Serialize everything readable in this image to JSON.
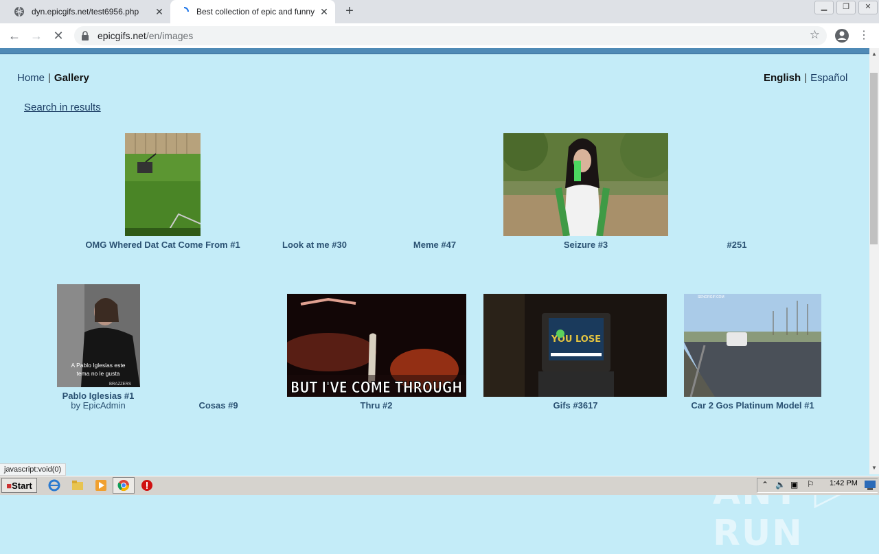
{
  "browser": {
    "tabs": [
      {
        "title": "dyn.epicgifs.net/test6956.php",
        "active": false
      },
      {
        "title": "Best collection of epic and funny gifs",
        "active": true
      }
    ],
    "url_host": "epicgifs.net",
    "url_path": "/en/images",
    "new_tab": "+",
    "window_controls": [
      "minimize",
      "maximize",
      "close"
    ]
  },
  "nav": {
    "home": "Home",
    "gallery": "Gallery",
    "separator": "|",
    "lang_en": "English",
    "lang_es": "Español"
  },
  "search_link": "Search in results",
  "gallery": {
    "row1": [
      {
        "title": "OMG Whered Dat Cat Come From #1",
        "has_thumb": true
      },
      {
        "title": "Look at me #30",
        "has_thumb": false
      },
      {
        "title": "Meme #47",
        "has_thumb": false
      },
      {
        "title": "Seizure #3",
        "has_thumb": true
      },
      {
        "title": "#251",
        "has_thumb": false
      }
    ],
    "row2": [
      {
        "title": "Pablo Iglesias #1",
        "byline": "by EpicAdmin",
        "has_thumb": true,
        "thumb_text": "A Pablo Iglesias este tema no le gusta",
        "thumb_tag": "BRAZZERS"
      },
      {
        "title": "Cosas #9",
        "has_thumb": false
      },
      {
        "title": "Thru #2",
        "has_thumb": true,
        "thumb_text": "BUT I'VE COME THROUGH"
      },
      {
        "title": "Gifs #3617",
        "has_thumb": true,
        "thumb_text": "YOU LOSE"
      },
      {
        "title": "Car 2 Gos Platinum Model #1",
        "has_thumb": true,
        "thumb_tag": "SENORGIF.COM"
      }
    ]
  },
  "status_bar": "javascript:void(0)",
  "watermark": "ANY ▷ RUN",
  "taskbar": {
    "start": "Start",
    "clock": "1:42 PM"
  }
}
